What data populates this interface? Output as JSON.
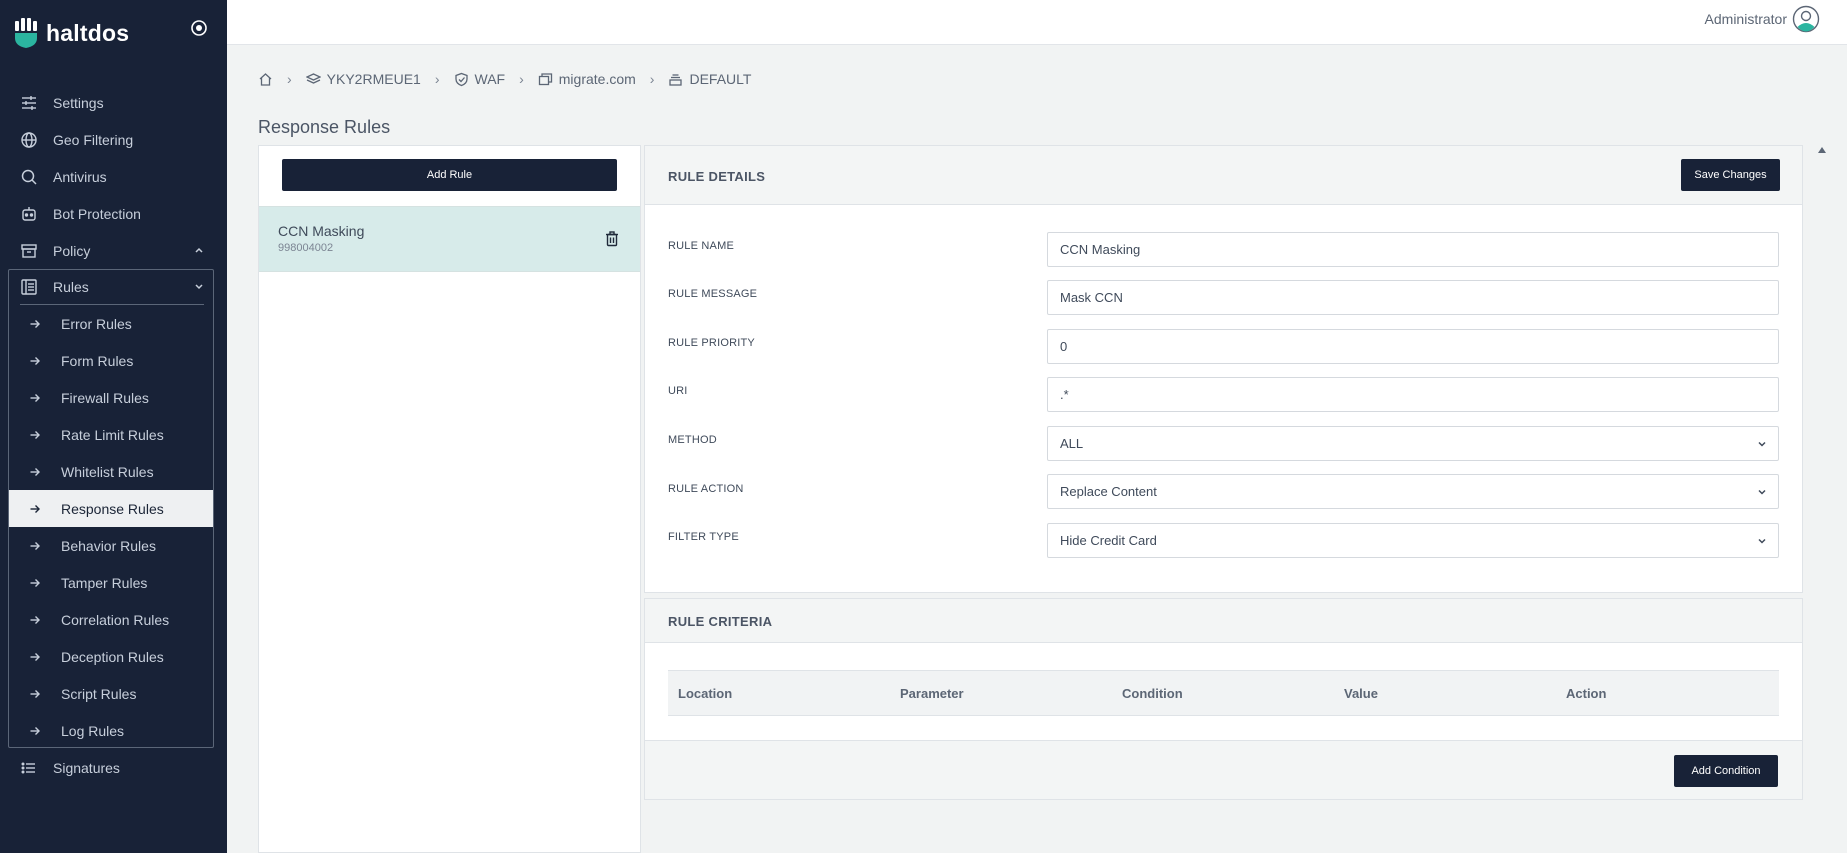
{
  "brand": {
    "name": "haltdos"
  },
  "topbar": {
    "user": "Administrator"
  },
  "sidebar": {
    "items": [
      {
        "label": "Settings",
        "icon": "sliders-icon"
      },
      {
        "label": "Geo Filtering",
        "icon": "globe-icon"
      },
      {
        "label": "Antivirus",
        "icon": "search-icon"
      },
      {
        "label": "Bot Protection",
        "icon": "robot-icon"
      },
      {
        "label": "Policy",
        "icon": "archive-icon"
      }
    ],
    "rules_label": "Rules",
    "rules_sub": [
      "Error Rules",
      "Form Rules",
      "Firewall Rules",
      "Rate Limit Rules",
      "Whitelist Rules",
      "Response Rules",
      "Behavior Rules",
      "Tamper Rules",
      "Correlation Rules",
      "Deception Rules",
      "Script Rules",
      "Log Rules"
    ],
    "active_sub": "Response Rules",
    "signatures_label": "Signatures"
  },
  "breadcrumb": {
    "items": [
      "YKY2RMEUE1",
      "WAF",
      "migrate.com",
      "DEFAULT"
    ],
    "separator": "›"
  },
  "page": {
    "title": "Response Rules"
  },
  "rule_list": {
    "add_label": "Add Rule",
    "items": [
      {
        "name": "CCN Masking",
        "id": "998004002"
      }
    ]
  },
  "details": {
    "title": "RULE DETAILS",
    "save_label": "Save Changes",
    "fields": {
      "rule_name": {
        "label": "RULE NAME",
        "value": "CCN Masking"
      },
      "rule_message": {
        "label": "RULE MESSAGE",
        "value": "Mask CCN"
      },
      "rule_priority": {
        "label": "RULE PRIORITY",
        "value": "0"
      },
      "uri": {
        "label": "URI",
        "value": ".*"
      },
      "method": {
        "label": "METHOD",
        "value": "ALL"
      },
      "rule_action": {
        "label": "RULE ACTION",
        "value": "Replace Content"
      },
      "filter_type": {
        "label": "FILTER TYPE",
        "value": "Hide Credit Card"
      }
    }
  },
  "criteria": {
    "title": "RULE CRITERIA",
    "columns": [
      "Location",
      "Parameter",
      "Condition",
      "Value",
      "Action"
    ],
    "add_label": "Add Condition"
  },
  "colors": {
    "sidebar_bg": "#182237",
    "accent": "#2bb5a0",
    "active_row": "#d7ebea"
  }
}
